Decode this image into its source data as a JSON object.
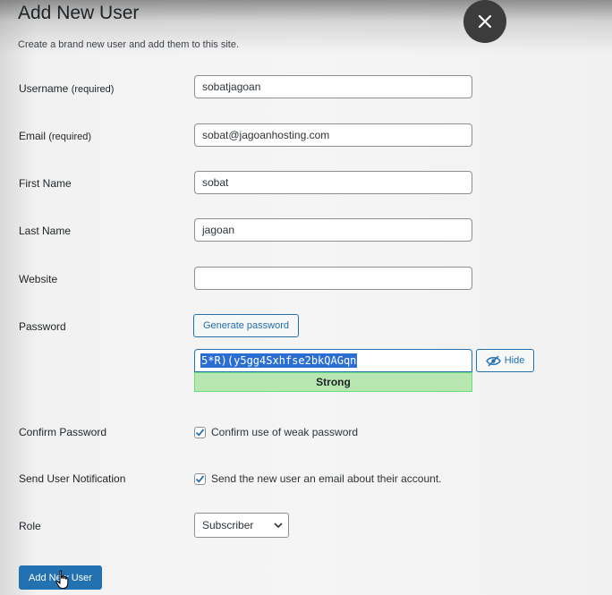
{
  "header": {
    "title": "Add New User",
    "description": "Create a brand new user and add them to this site."
  },
  "form": {
    "username": {
      "label": "Username",
      "required": "(required)",
      "value": "sobatjagoan"
    },
    "email": {
      "label": "Email",
      "required": "(required)",
      "value": "sobat@jagoanhosting.com"
    },
    "first_name": {
      "label": "First Name",
      "value": "sobat"
    },
    "last_name": {
      "label": "Last Name",
      "value": "jagoan"
    },
    "website": {
      "label": "Website",
      "value": ""
    },
    "password": {
      "label": "Password",
      "generate_label": "Generate password",
      "value": "5*R)(y5gg4Sxhfse2bkQAGqn",
      "hide_label": "Hide",
      "strength": "Strong"
    },
    "confirm_password": {
      "label": "Confirm Password",
      "checkbox_label": "Confirm use of weak password",
      "checked": true
    },
    "notification": {
      "label": "Send User Notification",
      "checkbox_label": "Send the new user an email about their account.",
      "checked": true
    },
    "role": {
      "label": "Role",
      "selected": "Subscriber"
    },
    "submit_label": "Add New User"
  },
  "colors": {
    "primary": "#2271b1",
    "strength_bg": "#b8e6b0",
    "selection": "#2a6ed1",
    "close_bg": "#3c3c3c"
  },
  "icons": {
    "close": "close-icon",
    "hide": "eye-slash-icon",
    "check": "check-icon",
    "dropdown": "chevron-down-icon",
    "cursor": "hand-pointer-icon"
  }
}
